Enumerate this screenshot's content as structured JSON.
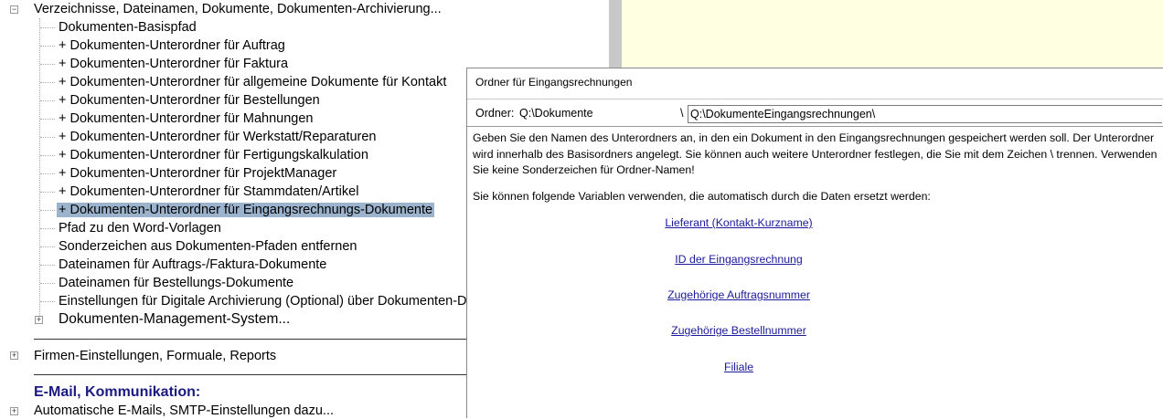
{
  "tree": {
    "root_label": "Verzeichnisse, Dateinamen, Dokumente, Dokumenten-Archivierung...",
    "items": [
      "Dokumenten-Basispfad",
      "+ Dokumenten-Unterordner für Auftrag",
      "+ Dokumenten-Unterordner für Faktura",
      "+ Dokumenten-Unterordner für allgemeine Dokumente für Kontakt",
      "+ Dokumenten-Unterordner für Bestellungen",
      "+ Dokumenten-Unterordner für Mahnungen",
      "+ Dokumenten-Unterordner für Werkstatt/Reparaturen",
      "+ Dokumenten-Unterordner für Fertigungskalkulation",
      "+ Dokumenten-Unterordner für ProjektManager",
      "+ Dokumenten-Unterordner für Stammdaten/Artikel",
      "+ Dokumenten-Unterordner für Eingangsrechnungs-Dokumente",
      "Pfad zu den Word-Vorlagen",
      "Sonderzeichen aus Dokumenten-Pfaden entfernen",
      "Dateinamen für Auftrags-/Faktura-Dokumente",
      "Dateinamen für Bestellungs-Dokumente",
      "Einstellungen für Digitale Archivierung (Optional) über Dokumenten-D"
    ],
    "dms_label": "Dokumenten-Management-System...",
    "firmen_label": "Firmen-Einstellungen, Formuale, Reports",
    "email_heading": "E-Mail, Kommunikation:",
    "email_item": "Automatische E-Mails, SMTP-Einstellungen dazu...",
    "expand_plus": "+",
    "expand_minus": "−"
  },
  "dialog": {
    "title": "Ordner für Eingangsrechnungen",
    "ordner_label": "Ordner:",
    "ordner_base": "Q:\\Dokumente",
    "separator": "\\",
    "ordner_value": "Q:\\DokumenteEingangsrechnungen\\",
    "info_text": "Geben Sie den Namen des Unterordners an, in den ein Dokument in den Eingangsrechnungen gespeichert werden soll. Der Unterordner wird innerhalb des Basisordners angelegt. Sie können auch weitere Unterordner festlegen, die Sie mit dem Zeichen \\ trennen. Verwenden Sie keine Sonderzeichen für Ordner-Namen!",
    "vars_intro": "Sie können folgende Variablen verwenden, die automatisch durch die Daten ersetzt werden:",
    "variables": [
      "Lieferant (Kontakt-Kurzname)",
      "ID der Eingangsrechnung",
      "Zugehörige Auftragsnummer",
      "Zugehörige Bestellnummer",
      "Filiale"
    ]
  },
  "colors": {
    "selection": "#9bb3cd",
    "link": "#1a1a9a",
    "heading": "#1a1a80",
    "side_panel": "#ffffe1"
  }
}
